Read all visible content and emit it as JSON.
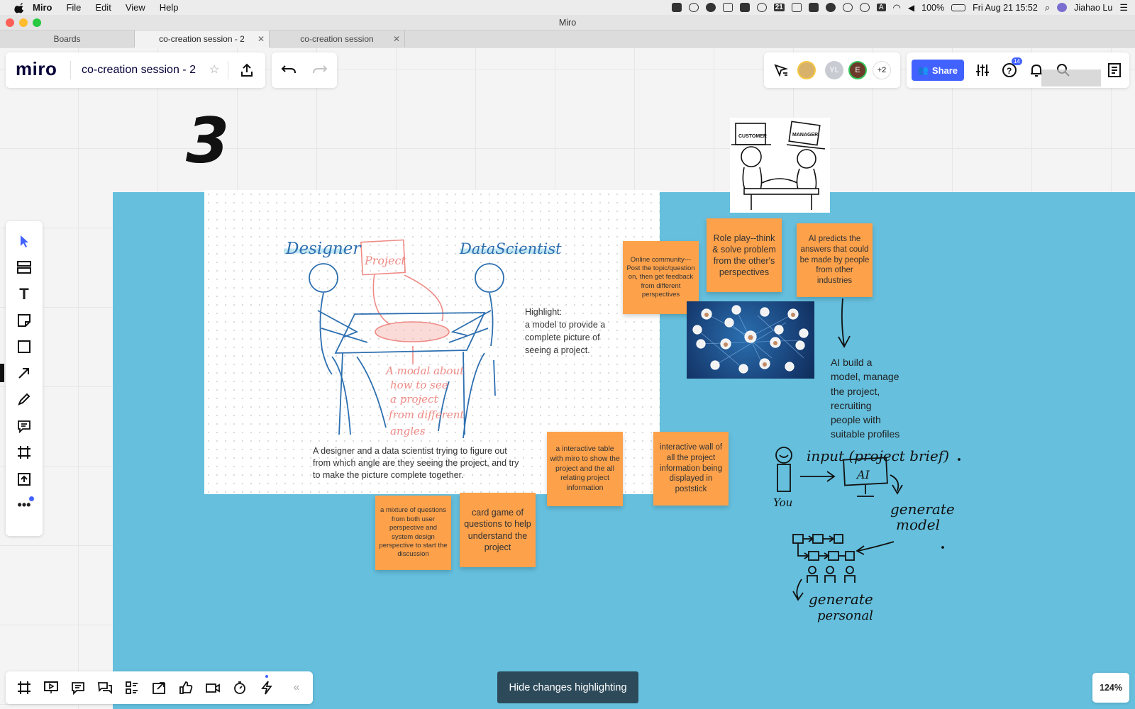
{
  "menubar": {
    "app_name": "Miro",
    "menus": [
      "File",
      "Edit",
      "View",
      "Help"
    ],
    "calendar_day": "21",
    "battery": "100%",
    "datetime": "Fri Aug 21  15:52",
    "user": "Jiahao Lu"
  },
  "window": {
    "title": "Miro"
  },
  "tabs": [
    {
      "label": "Boards"
    },
    {
      "label": "co-creation session - 2"
    },
    {
      "label": "co-creation session"
    }
  ],
  "board_header": {
    "logo": "miro",
    "title": "co-creation session - 2"
  },
  "collaborators": {
    "avatar_initials": [
      "YL",
      "E"
    ],
    "more_count": "+2",
    "share_label": "Share",
    "help_badge": "14"
  },
  "canvas": {
    "big_number": "3",
    "frame": {
      "label_designer": "Designer",
      "label_scientist": "DataScientist",
      "label_project": "Project",
      "sketch_note": [
        "A modal about",
        "how to see",
        "a project",
        "from different",
        "angles"
      ],
      "highlight": [
        "Highlight:",
        "a model to provide a",
        "complete picture of",
        "seeing a project."
      ],
      "caption": [
        "A designer and a data scientist trying to figure out",
        "from which angle are they seeing the project, and try",
        "to make the picture complete together."
      ]
    },
    "stickies": [
      {
        "text": "Online community---Post the topic/question on, then get feedback from different perspectives"
      },
      {
        "text": "Role play--think & solve problem from the other's perspectives"
      },
      {
        "text": "AI predicts the answers that could be made by people from other industries"
      },
      {
        "text": "a interactive table with miro to show the project and the all relating project information"
      },
      {
        "text": "interactive wall of all the project information being displayed in poststick"
      },
      {
        "text": "a mixture of questions from both user perspective and system design perspective to start the discussion"
      },
      {
        "text": "card game of questions to help understand the project"
      }
    ],
    "hat_labels": [
      "CUSTOMER",
      "MANAGER"
    ],
    "ai_note": [
      "AI build a",
      "model, manage",
      "the project,",
      "recruiting",
      "people with",
      "suitable profiles"
    ],
    "handwriting": {
      "input": "input (project brief)",
      "ai": "AI",
      "you": "You",
      "generate_model": [
        "generate",
        "model"
      ],
      "generate_personal": [
        "generate",
        "personal"
      ]
    }
  },
  "footer": {
    "hide_changes_label": "Hide changes highlighting",
    "collapse_label": "«",
    "zoom": "124%"
  },
  "colors": {
    "canvas_blue": "#65bfdd",
    "sticky_orange": "#fda14b",
    "share_blue": "#4262ff",
    "sketch_blue": "#2d6fb0",
    "sketch_red": "#ee8b86"
  }
}
